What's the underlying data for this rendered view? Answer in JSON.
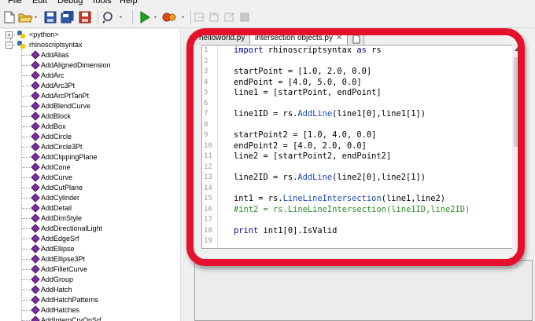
{
  "menu": [
    "File",
    "Edit",
    "Debug",
    "Tools",
    "Help"
  ],
  "toolbar": {
    "icons": [
      "new-file-icon",
      "open-folder-icon",
      "save-icon",
      "save-all-icon",
      "save-as-icon",
      "find-icon",
      "run-icon",
      "debug-icon",
      "step-into-icon",
      "step-over-icon",
      "step-out-icon",
      "stop-icon"
    ]
  },
  "tree": {
    "roots": [
      "<python>",
      "rhinoscriptsyntax"
    ],
    "items": [
      "AddAlias",
      "AddAlignedDimension",
      "AddArc",
      "AddArc3Pt",
      "AddArcPtTanPt",
      "AddBlendCurve",
      "AddBlock",
      "AddBox",
      "AddCircle",
      "AddCircle3Pt",
      "AddClippingPlane",
      "AddCone",
      "AddCurve",
      "AddCutPlane",
      "AddCylinder",
      "AddDetail",
      "AddDimStyle",
      "AddDirectionalLight",
      "AddEdgeSrf",
      "AddEllipse",
      "AddEllipse3Pt",
      "AddFilletCurve",
      "AddGroup",
      "AddHatch",
      "AddHatchPatterns",
      "AddHatches",
      "AddInterpCrvOnSrf",
      "AddInterpCrvOnSrfUV"
    ]
  },
  "tabs": [
    {
      "label": "helloworld.py",
      "active": false
    },
    {
      "label": "intersection objects.py",
      "active": true
    }
  ],
  "editor": {
    "lines": [
      [
        [
          "kw",
          "import"
        ],
        [
          "t",
          " rhinoscriptsyntax "
        ],
        [
          "kw",
          "as"
        ],
        [
          "t",
          " rs"
        ]
      ],
      [],
      [
        [
          "t",
          "startPoint = [1.0, 2.0, 0.0]"
        ]
      ],
      [
        [
          "t",
          "endPoint = [4.0, 5.0, 0.0]"
        ]
      ],
      [
        [
          "t",
          "line1 = [startPoint, endPoint]"
        ]
      ],
      [],
      [
        [
          "t",
          "line1ID = rs."
        ],
        [
          "fn",
          "AddLine"
        ],
        [
          "t",
          "(line1[0],line1[1])"
        ]
      ],
      [],
      [
        [
          "t",
          "startPoint2 = [1.0, 4.0, 0.0]"
        ]
      ],
      [
        [
          "t",
          "endPoint2 = [4.0, 2.0, 0.0]"
        ]
      ],
      [
        [
          "t",
          "line2 = [startPoint2, endPoint2]"
        ]
      ],
      [],
      [
        [
          "t",
          "line2ID = rs."
        ],
        [
          "fn",
          "AddLine"
        ],
        [
          "t",
          "(line2[0],line2[1])"
        ]
      ],
      [],
      [
        [
          "t",
          "int1 = rs."
        ],
        [
          "fn",
          "LineLineIntersection"
        ],
        [
          "t",
          "(line1,line2)"
        ]
      ],
      [
        [
          "cm",
          "#int2 = rs.LineLineIntersection(line1ID,line2ID)"
        ]
      ],
      [],
      [
        [
          "kw",
          "print"
        ],
        [
          "t",
          " int1[0].IsValid"
        ]
      ],
      []
    ]
  },
  "colors": {
    "highlight": "#e5102b",
    "keyword": "#00008b",
    "function": "#1a47b8",
    "comment": "#2f8f2f",
    "tree_icon": "#7b2fa0"
  }
}
